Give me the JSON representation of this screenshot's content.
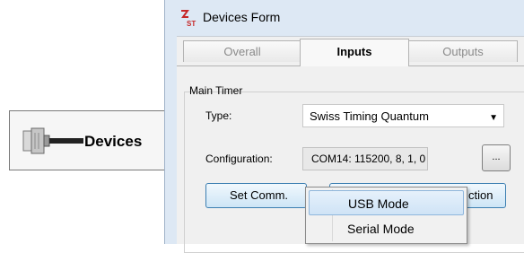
{
  "toolbar": {
    "devices_label": "Devices",
    "devices_icon": "serial-plug-icon"
  },
  "window": {
    "title": "Devices Form",
    "icon": "st-app-icon"
  },
  "tabs": [
    {
      "label": "Overall",
      "active": false
    },
    {
      "label": "Inputs",
      "active": true
    },
    {
      "label": "Outputs",
      "active": false
    }
  ],
  "main_timer": {
    "group_label": "Main Timer",
    "type_label": "Type:",
    "type_value": "Swiss Timing Quantum",
    "config_label": "Configuration:",
    "config_value": "COM14: 115200, 8, 1, 0",
    "browse_label": "...",
    "set_comm_label": "Set Comm.",
    "second_button_partial_label": "ction"
  },
  "context_menu": {
    "items": [
      {
        "label": "USB Mode",
        "highlighted": true
      },
      {
        "label": "Serial Mode",
        "highlighted": false
      }
    ]
  },
  "colors": {
    "window_frame": "#dde8f4",
    "client": "#f0f0f0",
    "button_border": "#3c7fb1",
    "menu_highlight": "#cfe3f6"
  }
}
